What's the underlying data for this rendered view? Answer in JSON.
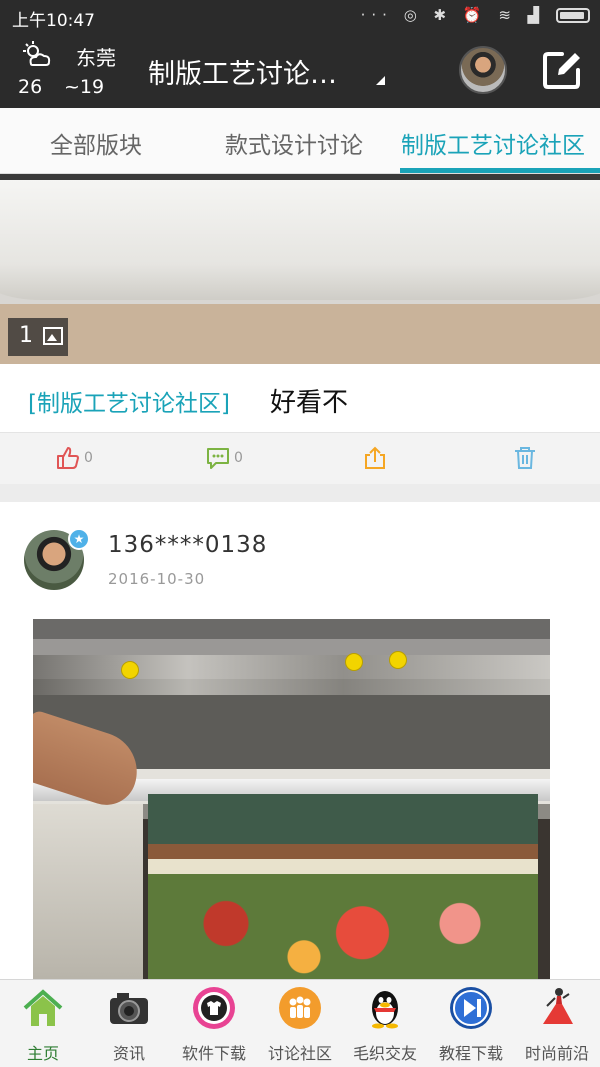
{
  "status_bar": {
    "time": "上午10:47",
    "icons": [
      "more-dots-icon",
      "sync-icon",
      "bluetooth-icon",
      "alarm-icon",
      "wifi-icon",
      "signal-icon",
      "battery-icon"
    ],
    "icons_text": "··· ◎ ✱ ⏰ ≋ ▟"
  },
  "header": {
    "weather": {
      "city": "东莞",
      "high": "26",
      "low": "~19",
      "icon": "partly-cloudy-icon"
    },
    "title": "制版工艺讨论…",
    "avatar_icon": "user-avatar",
    "edit_icon": "edit-icon"
  },
  "tabs": [
    {
      "label": "全部版块",
      "active": false
    },
    {
      "label": "款式设计讨论",
      "active": false
    },
    {
      "label": "制版工艺讨论社区",
      "active": true
    }
  ],
  "post1": {
    "image_count": "1",
    "tag": "[制版工艺讨论社区]",
    "text": "好看不",
    "likes": "0",
    "comments": "0"
  },
  "post2": {
    "user": "136****0138",
    "date": "2016-10-30"
  },
  "bottom_nav": [
    {
      "label": "主页",
      "icon": "home-icon",
      "active": true
    },
    {
      "label": "资讯",
      "icon": "camera-icon",
      "active": false
    },
    {
      "label": "软件下载",
      "icon": "tshirt-icon",
      "active": false
    },
    {
      "label": "讨论社区",
      "icon": "group-icon",
      "active": false
    },
    {
      "label": "毛织交友",
      "icon": "penguin-icon",
      "active": false
    },
    {
      "label": "教程下载",
      "icon": "play-next-icon",
      "active": false
    },
    {
      "label": "时尚前沿",
      "icon": "fashion-model-icon",
      "active": false
    }
  ],
  "colors": {
    "accent": "#1aa3b8",
    "header_bg": "#2b2b2b",
    "home_green": "#2e7d32"
  }
}
